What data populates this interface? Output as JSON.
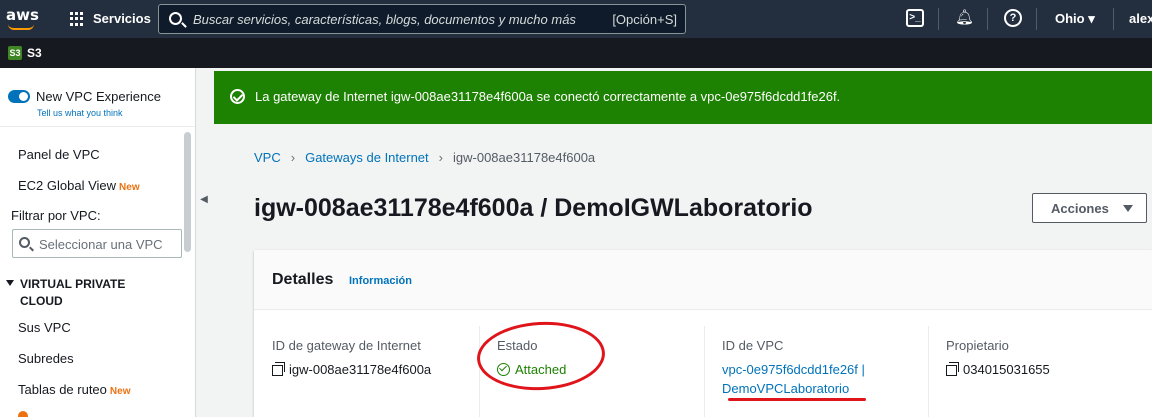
{
  "topnav": {
    "logo": "aws",
    "services_label": "Servicios",
    "search_placeholder": "Buscar servicios, características, blogs, documentos y mucho más",
    "search_shortcut": "[Opción+S]",
    "region": "Ohio ▾",
    "user": "alex"
  },
  "servicebar": {
    "service": "S3",
    "icon": "S3"
  },
  "sidebar": {
    "experience_title": "New VPC Experience",
    "experience_link": "Tell us what you think",
    "panel_vpc": "Panel de VPC",
    "ec2_global": "EC2 Global View",
    "new_badge": "New",
    "filter_label": "Filtrar por VPC:",
    "filter_placeholder": "Seleccionar una VPC",
    "section_title": "VIRTUAL PRIVATE CLOUD",
    "sus_vpc": "Sus VPC",
    "subredes": "Subredes",
    "tablas": "Tablas de ruteo",
    "tablas_badge": "New"
  },
  "flash": {
    "message": "La gateway de Internet igw-008ae31178e4f600a se conectó correctamente a vpc-0e975f6dcdd1fe26f.",
    "color": "#1d8102"
  },
  "breadcrumb": {
    "root": "VPC",
    "parent": "Gateways de Internet",
    "current": "igw-008ae31178e4f600a"
  },
  "page": {
    "title": "igw-008ae31178e4f600a / DemoIGWLaboratorio",
    "actions_label": "Acciones"
  },
  "details": {
    "title": "Detalles",
    "info_link": "Información",
    "gateway_id_label": "ID de gateway de Internet",
    "gateway_id_value": "igw-008ae31178e4f600a",
    "state_label": "Estado",
    "state_value": "Attached",
    "vpc_id_label": "ID de VPC",
    "vpc_id_line1": "vpc-0e975f6dcdd1fe26f |",
    "vpc_id_line2": "DemoVPCLaboratorio",
    "owner_label": "Propietario",
    "owner_value": "034015031655"
  },
  "colors": {
    "accent": "#0073bb",
    "success": "#1d8102",
    "annotation": "#e0151b",
    "nav": "#232f3e"
  }
}
